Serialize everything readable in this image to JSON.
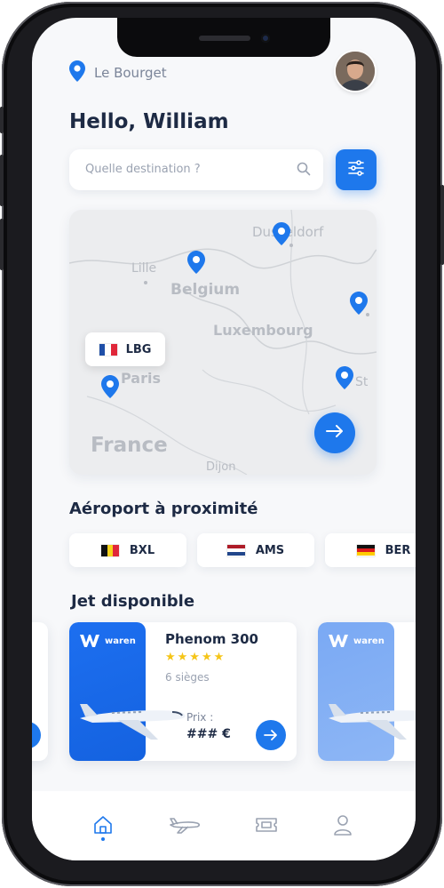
{
  "location": {
    "name": "Le Bourget",
    "icon": "map-pin-icon"
  },
  "user": {
    "greeting": "Hello, William",
    "avatar": "avatar"
  },
  "search": {
    "placeholder": "Quelle destination ?",
    "icon": "search-icon",
    "filter_icon": "filter-sliders-icon"
  },
  "map": {
    "labels": [
      "Lille",
      "Belgium",
      "Dusseldorf",
      "Luxembourg",
      "Paris",
      "France",
      "Dijon",
      "St"
    ],
    "selected_airport": {
      "code": "LBG",
      "flag": "fr"
    },
    "go_icon": "arrow-right-icon"
  },
  "nearby": {
    "title": "Aéroport à proximité",
    "airports": [
      {
        "code": "BXL",
        "flag": "be"
      },
      {
        "code": "AMS",
        "flag": "nl"
      },
      {
        "code": "BER",
        "flag": "de"
      }
    ]
  },
  "jets": {
    "title": "Jet disponible",
    "brand": "waren",
    "featured": {
      "name": "Phenom 300",
      "stars": "★★★★★",
      "rating": 5,
      "seats": "6 sièges",
      "price_label": "Prix :",
      "price": "### €"
    }
  },
  "tabs": [
    "home-icon",
    "plane-icon",
    "ticket-icon",
    "user-icon"
  ],
  "colors": {
    "accent": "#1e78ec",
    "text": "#1d2a44",
    "muted": "#9aa2b1",
    "star": "#f5c518"
  }
}
